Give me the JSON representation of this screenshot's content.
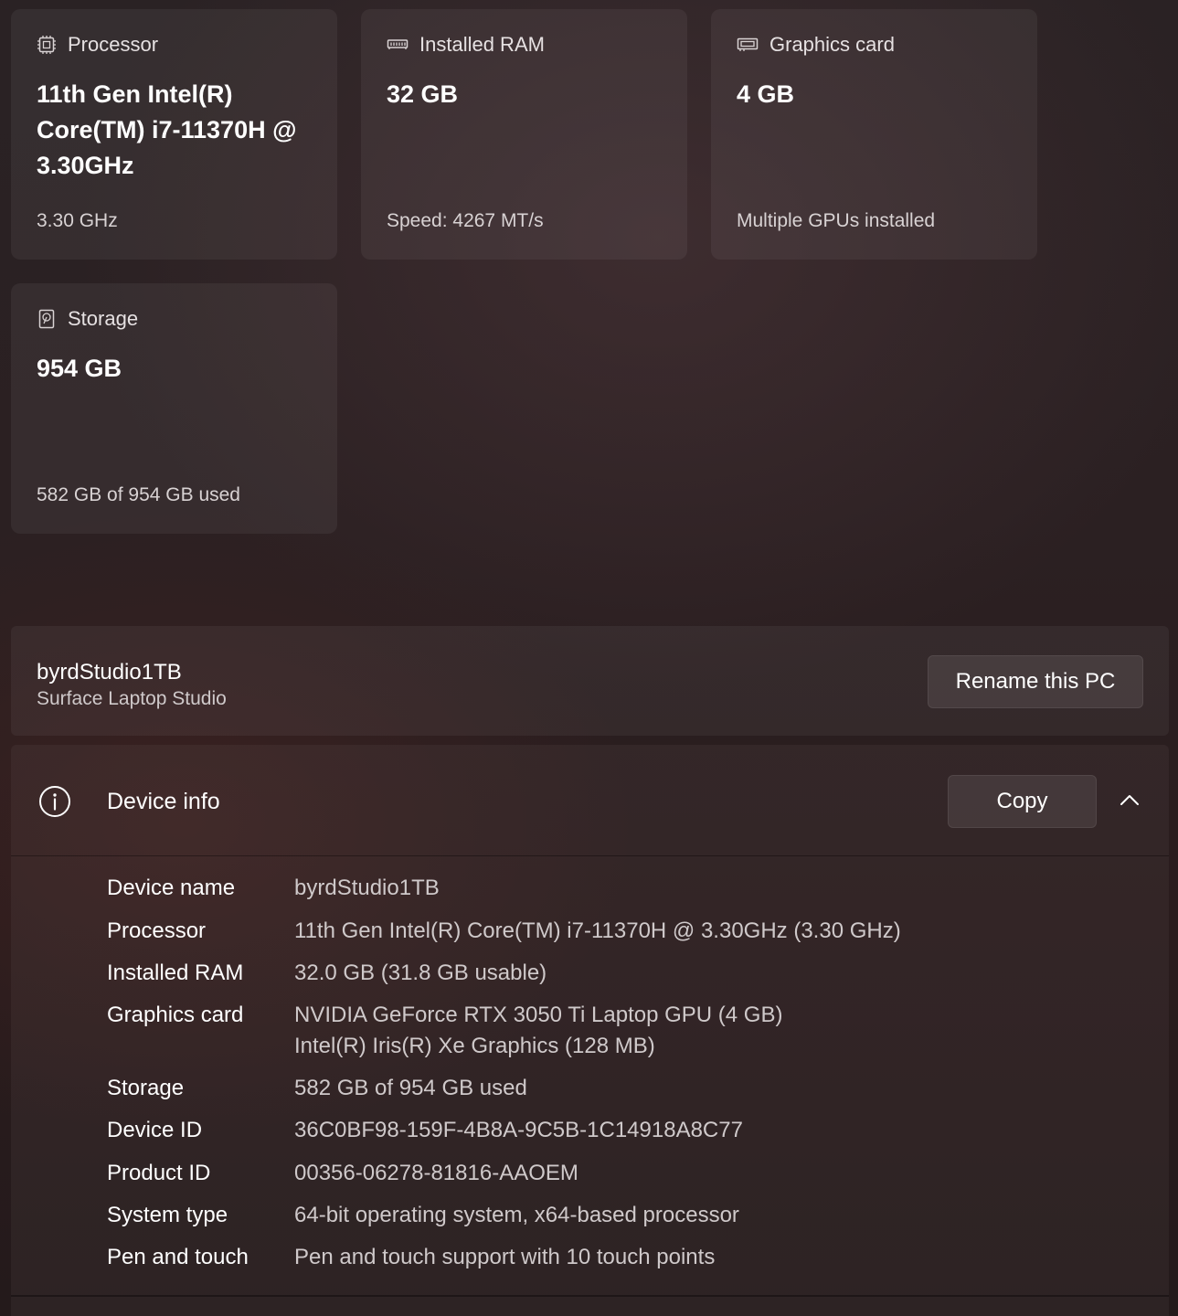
{
  "cards": {
    "processor": {
      "label": "Processor",
      "icon": "processor-chip-icon",
      "value": "11th Gen Intel(R) Core(TM) i7-11370H @ 3.30GHz",
      "sub": "3.30 GHz"
    },
    "ram": {
      "label": "Installed RAM",
      "icon": "ram-module-icon",
      "value": "32 GB",
      "sub": "Speed: 4267 MT/s"
    },
    "gpu": {
      "label": "Graphics card",
      "icon": "graphics-card-icon",
      "value": "4 GB",
      "sub": "Multiple GPUs installed"
    },
    "storage": {
      "label": "Storage",
      "icon": "storage-drive-icon",
      "value": "954 GB",
      "sub": "582 GB of 954 GB used"
    }
  },
  "pc": {
    "name": "byrdStudio1TB",
    "model": "Surface Laptop Studio",
    "rename_label": "Rename this PC"
  },
  "device_info": {
    "title": "Device info",
    "icon": "info-icon",
    "copy_label": "Copy",
    "collapse_icon": "chevron-up-icon",
    "rows": [
      {
        "label": "Device name",
        "value": "byrdStudio1TB"
      },
      {
        "label": "Processor",
        "value": "11th Gen Intel(R) Core(TM) i7-11370H @ 3.30GHz (3.30 GHz)"
      },
      {
        "label": "Installed RAM",
        "value": "32.0 GB (31.8 GB usable)"
      },
      {
        "label": "Graphics card",
        "value": "NVIDIA GeForce RTX 3050 Ti Laptop GPU (4 GB)",
        "value2": "Intel(R) Iris(R) Xe Graphics (128 MB)"
      },
      {
        "label": "Storage",
        "value": "582 GB of 954 GB used"
      },
      {
        "label": "Device ID",
        "value": "36C0BF98-159F-4B8A-9C5B-1C14918A8C77"
      },
      {
        "label": "Product ID",
        "value": "00356-06278-81816-AAOEM"
      },
      {
        "label": "System type",
        "value": "64-bit operating system, x64-based processor"
      },
      {
        "label": "Pen and touch",
        "value": "Pen and touch support with 10 touch points"
      }
    ]
  }
}
